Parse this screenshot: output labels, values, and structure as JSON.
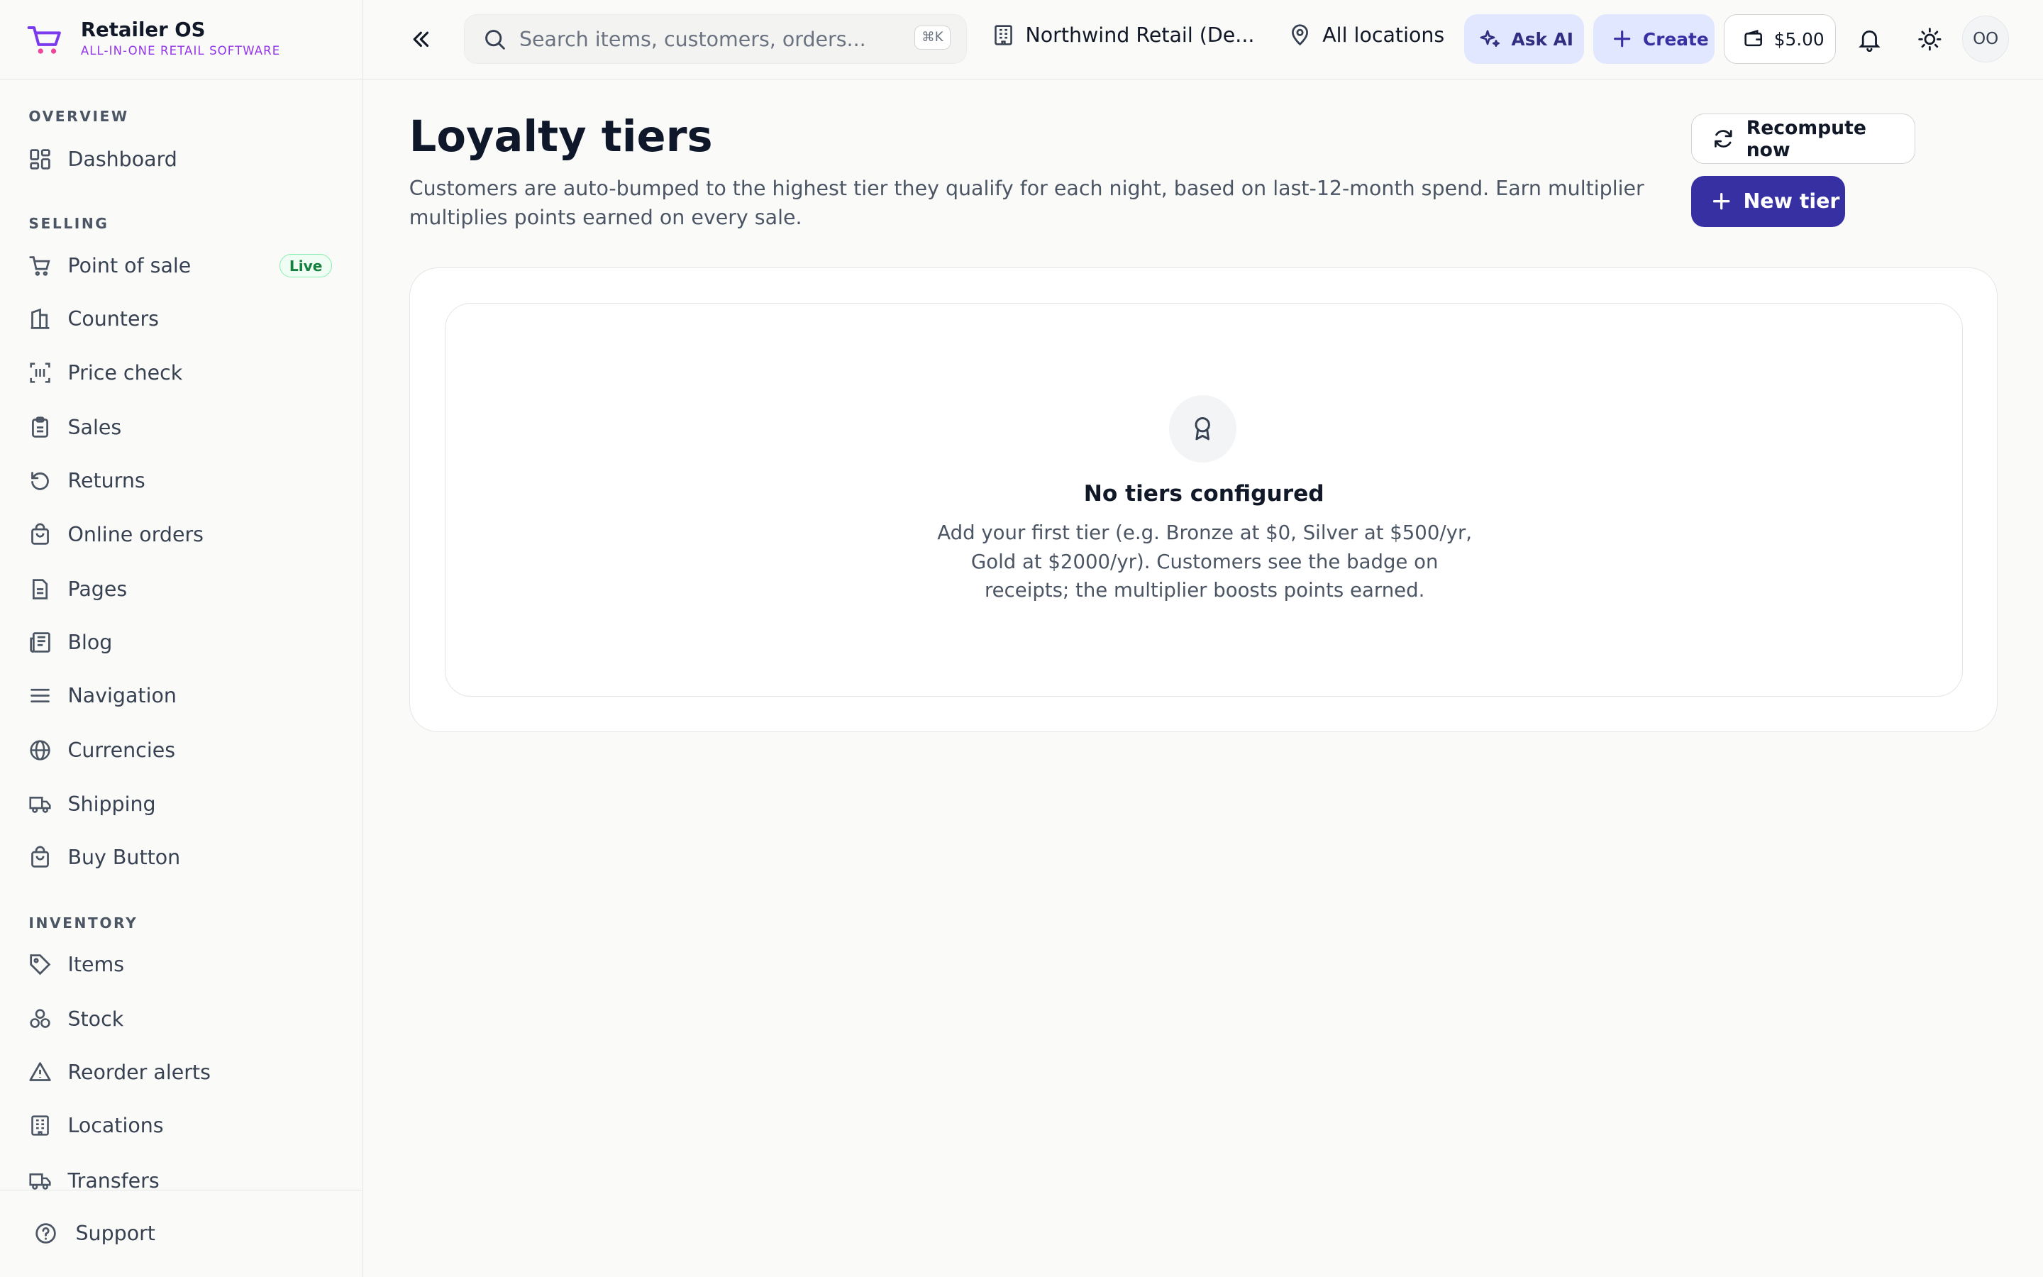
{
  "brand": {
    "name": "Retailer OS",
    "tagline": "ALL-IN-ONE RETAIL SOFTWARE",
    "accent": "#9333ea"
  },
  "sidebar": {
    "sections": [
      "OVERVIEW",
      "SELLING",
      "INVENTORY"
    ],
    "overview": [
      {
        "label": "Dashboard",
        "icon": "dashboard-icon"
      }
    ],
    "selling": [
      {
        "label": "Point of sale",
        "icon": "cart-icon",
        "badge": "Live"
      },
      {
        "label": "Counters",
        "icon": "counter-icon"
      },
      {
        "label": "Price check",
        "icon": "barcode-icon"
      },
      {
        "label": "Sales",
        "icon": "clipboard-icon"
      },
      {
        "label": "Returns",
        "icon": "undo-icon"
      },
      {
        "label": "Online orders",
        "icon": "shopping-bag-icon"
      },
      {
        "label": "Pages",
        "icon": "document-icon"
      },
      {
        "label": "Blog",
        "icon": "newspaper-icon"
      },
      {
        "label": "Navigation",
        "icon": "menu-icon"
      },
      {
        "label": "Currencies",
        "icon": "globe-icon"
      },
      {
        "label": "Shipping",
        "icon": "truck-icon"
      },
      {
        "label": "Buy Button",
        "icon": "shopping-bag-icon"
      }
    ],
    "inventory": [
      {
        "label": "Items",
        "icon": "tag-icon"
      },
      {
        "label": "Stock",
        "icon": "boxes-icon"
      },
      {
        "label": "Reorder alerts",
        "icon": "alert-triangle-icon"
      },
      {
        "label": "Locations",
        "icon": "building-icon"
      },
      {
        "label": "Transfers",
        "icon": "truck-icon"
      }
    ],
    "support": "Support"
  },
  "topbar": {
    "search_placeholder": "Search items, customers, orders...",
    "search_shortcut": "⌘K",
    "organization": "Northwind Retail (De...",
    "location": "All locations",
    "ask_ai": "Ask AI",
    "create": "Create",
    "wallet": "$5.00",
    "avatar": "OO"
  },
  "page": {
    "title": "Loyalty tiers",
    "description": "Customers are auto-bumped to the highest tier they qualify for each night, based on last-12-month spend. Earn multiplier multiplies points earned on every sale.",
    "recompute_label": "Recompute now",
    "new_tier_label": "New tier",
    "primary_color": "#3730a3"
  },
  "empty_state": {
    "title": "No tiers configured",
    "text": "Add your first tier (e.g. Bronze at $0, Silver at $500/yr, Gold at $2000/yr). Customers see the badge on receipts; the multiplier boosts points earned."
  }
}
